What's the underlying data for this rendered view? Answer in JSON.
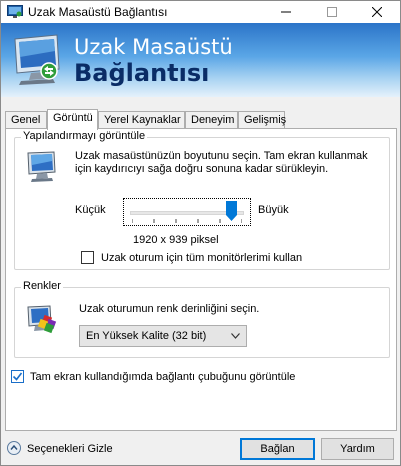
{
  "window": {
    "title": "Uzak Masaüstü Bağlantısı",
    "minimize_glyph": "—",
    "maximize_glyph": "☐",
    "close_glyph": "✕"
  },
  "banner": {
    "line1": "Uzak Masaüstü",
    "line2": "Bağlantısı",
    "icon": "remote-desktop-icon"
  },
  "tabs": [
    {
      "label": "Genel",
      "active": false
    },
    {
      "label": "Görüntü",
      "active": true
    },
    {
      "label": "Yerel Kaynaklar",
      "active": false
    },
    {
      "label": "Deneyim",
      "active": false
    },
    {
      "label": "Gelişmiş",
      "active": false
    }
  ],
  "display_config": {
    "legend": "Yapılandırmayı görüntüle",
    "description_line1": "Uzak masaüstünüzün boyutunu seçin. Tam ekran kullanmak",
    "description_line2": "için kaydırıcıyı sağa doğru sonuna kadar sürükleyin.",
    "slider_min_label": "Küçük",
    "slider_max_label": "Büyük",
    "slider_value_fraction": 0.9,
    "resolution_text": "1920 x 939 piksel",
    "all_monitors_label": "Uzak oturum için tüm monitörlerimi kullan",
    "all_monitors_checked": false
  },
  "colors_group": {
    "legend": "Renkler",
    "description": "Uzak oturumun renk derinliğini seçin.",
    "selected_depth": "En Yüksek Kalite (32 bit)"
  },
  "fullscreen_bar": {
    "label": "Tam ekran kullandığımda bağlantı çubuğunu görüntüle",
    "checked": true
  },
  "footer": {
    "options_label": "Seçenekleri Gizle",
    "connect_label": "Bağlan",
    "help_label": "Yardım"
  },
  "colors": {
    "accent": "#0078d7",
    "banner_title_dark": "#0a2c66",
    "banner_top": "#2b74c8"
  }
}
